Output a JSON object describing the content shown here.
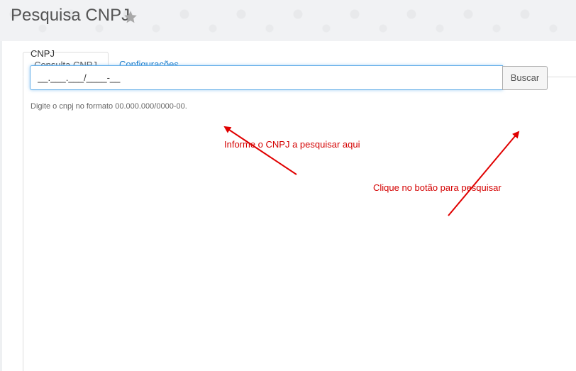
{
  "header": {
    "title": "Pesquisa CNPJ",
    "favorite_icon": "star-icon"
  },
  "tabs": [
    {
      "label": "Consulta CNPJ",
      "active": true
    },
    {
      "label": "Configurações",
      "active": false
    }
  ],
  "form": {
    "field_label": "CNPJ",
    "input_value": "__.___.___/____-__",
    "button_label": "Buscar",
    "help_text": "Digite o cnpj no formato 00.000.000/0000-00."
  },
  "annotations": {
    "input_hint": "Informe o CNPJ a pesquisar aqui",
    "button_hint": "Clique no botão para pesquisar",
    "color": "#d40000"
  },
  "colors": {
    "accent_link": "#1a7bc9",
    "focus_border": "#66afe9"
  }
}
